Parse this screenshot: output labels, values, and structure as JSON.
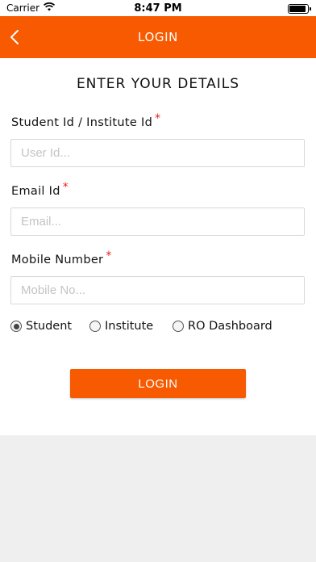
{
  "status_bar": {
    "carrier": "Carrier",
    "time": "8:47 PM"
  },
  "nav": {
    "title": "LOGIN",
    "back_icon": "chevron-left-icon"
  },
  "form": {
    "heading": "ENTER YOUR DETAILS",
    "fields": [
      {
        "label": "Student Id / Institute Id",
        "required_mark": "*",
        "placeholder": "User Id...",
        "value": ""
      },
      {
        "label": "Email Id",
        "required_mark": "*",
        "placeholder": "Email...",
        "value": ""
      },
      {
        "label": "Mobile Number",
        "required_mark": "*",
        "placeholder": "Mobile No...",
        "value": ""
      }
    ],
    "user_types": [
      {
        "label": "Student",
        "selected": true
      },
      {
        "label": "Institute",
        "selected": false
      },
      {
        "label": "RO Dashboard",
        "selected": false
      }
    ],
    "submit_label": "LOGIN"
  },
  "colors": {
    "brand": "#f75a00",
    "required": "#e82020",
    "background": "#efefef"
  }
}
